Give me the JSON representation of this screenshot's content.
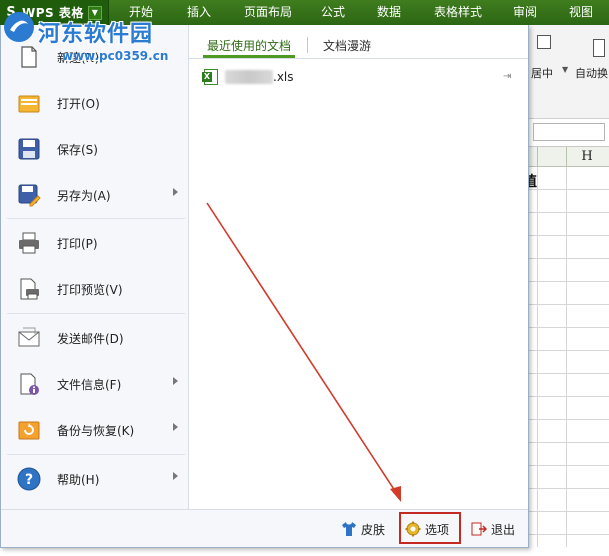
{
  "app": {
    "logo": "S",
    "title": "WPS 表格",
    "dropdown_icon": "chevron-down-icon"
  },
  "ribbon_tabs": [
    {
      "label": "开始"
    },
    {
      "label": "插入"
    },
    {
      "label": "页面布局"
    },
    {
      "label": "公式"
    },
    {
      "label": "数据"
    },
    {
      "label": "表格样式"
    },
    {
      "label": "审阅"
    },
    {
      "label": "视图"
    }
  ],
  "watermark": {
    "title": "河东软件园",
    "url": "www.pc0359.cn"
  },
  "ribbon_partial": {
    "merge_center": "居中",
    "auto_wrap": "自动换"
  },
  "sheet": {
    "column_h": "H",
    "cell_char": "值"
  },
  "file_menu": {
    "items": [
      {
        "label": "新建(N)",
        "icon": "new-file-icon",
        "has_submenu": false
      },
      {
        "label": "打开(O)",
        "icon": "open-folder-icon",
        "has_submenu": false
      },
      {
        "label": "保存(S)",
        "icon": "save-icon",
        "has_submenu": false
      },
      {
        "label": "另存为(A)",
        "icon": "save-as-icon",
        "has_submenu": true
      },
      {
        "label": "打印(P)",
        "icon": "printer-icon",
        "has_submenu": false
      },
      {
        "label": "打印预览(V)",
        "icon": "print-preview-icon",
        "has_submenu": false
      },
      {
        "label": "发送邮件(D)",
        "icon": "mail-icon",
        "has_submenu": false
      },
      {
        "label": "文件信息(F)",
        "icon": "file-info-icon",
        "has_submenu": true
      },
      {
        "label": "备份与恢复(K)",
        "icon": "backup-restore-icon",
        "has_submenu": true
      },
      {
        "label": "帮助(H)",
        "icon": "help-icon",
        "has_submenu": true
      }
    ],
    "tabs": [
      {
        "label": "最近使用的文档",
        "active": true
      },
      {
        "label": "文档漫游",
        "active": false
      }
    ],
    "recent_files": [
      {
        "name": ".xls",
        "icon": "xls-file-icon",
        "pin_icon": "pin-icon"
      }
    ],
    "bottom_buttons": [
      {
        "label": "皮肤",
        "icon": "shirt-icon"
      },
      {
        "label": "选项",
        "icon": "gear-icon"
      },
      {
        "label": "退出",
        "icon": "exit-icon"
      }
    ]
  },
  "colors": {
    "ribbon_green": "#3f7d1f",
    "accent_green": "#4f9a22",
    "highlight_red": "#c22a22"
  }
}
